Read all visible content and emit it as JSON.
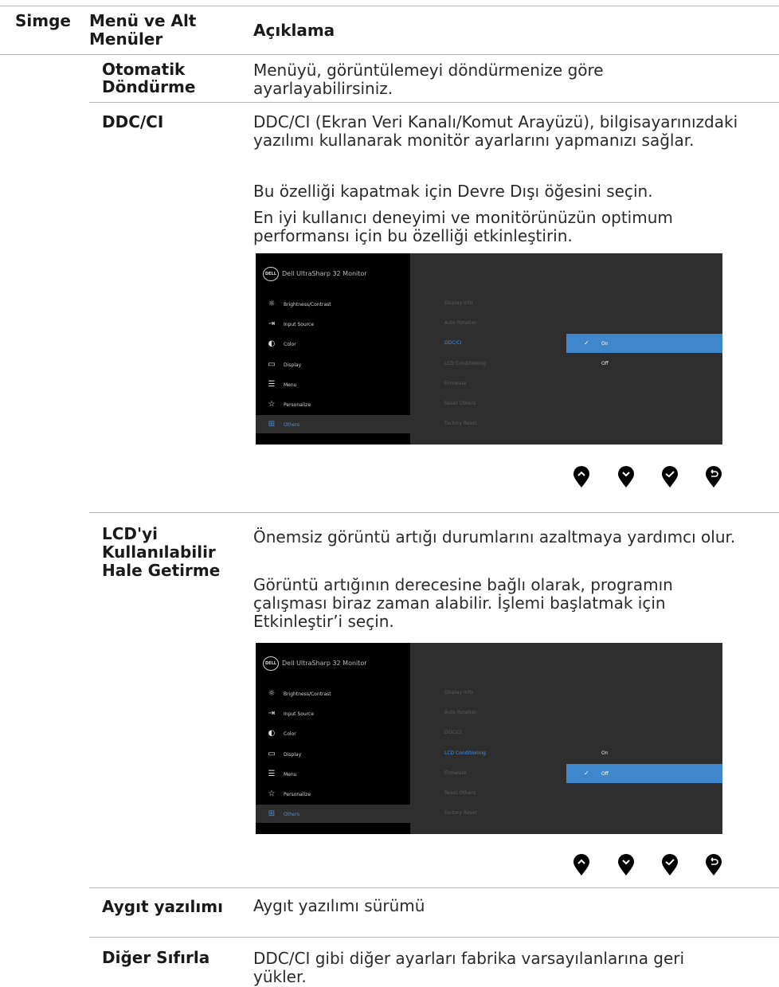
{
  "header": {
    "col1": "Simge",
    "col2": "Menü ve Alt Menüler",
    "col3": "Açıklama"
  },
  "rows": [
    {
      "term": "Otomatik Döndürme",
      "desc": [
        "Menüyü, görüntülemeyi döndürmenize göre ayarlayabilirsiniz."
      ]
    },
    {
      "term": "DDC/CI",
      "desc": [
        "DDC/CI (Ekran Veri Kanalı/Komut Arayüzü), bilgisayarınızdaki yazılımı kullanarak monitör ayarlarını yapmanızı sağlar.",
        "Bu özelliği kapatmak için Devre Dışı öğesini seçin.",
        "En iyi kullanıcı deneyimi ve monitörünüzün optimum performansı için bu özelliği etkinleştirin."
      ]
    },
    {
      "term": "LCD'yi Kullanılabilir Hale Getirme",
      "desc": [
        "Önemsiz görüntü artığı durumlarını azaltmaya yardımcı olur.",
        "Görüntü artığının derecesine bağlı olarak, programın çalışması biraz zaman alabilir. İşlemi başlatmak için Etkinleştir’i seçin."
      ]
    },
    {
      "term": "Aygıt yazılımı",
      "desc": [
        "Aygıt yazılımı sürümü"
      ]
    },
    {
      "term": "Diğer Sıfırla",
      "desc": [
        "DDC/CI gibi diğer ayarları fabrika varsayılanlarına geri yükler."
      ]
    }
  ],
  "osd": {
    "logo": "DELL",
    "title": "Dell UltraSharp 32 Monitor",
    "menu": [
      {
        "label": "Brightness/Contrast",
        "icon": "brightness-icon"
      },
      {
        "label": "Input Source",
        "icon": "input-source-icon"
      },
      {
        "label": "Color",
        "icon": "palette-icon"
      },
      {
        "label": "Display",
        "icon": "display-icon"
      },
      {
        "label": "Menu",
        "icon": "menu-icon"
      },
      {
        "label": "Personalize",
        "icon": "star-icon"
      },
      {
        "label": "Others",
        "icon": "others-icon"
      }
    ],
    "submenu": [
      "Display Info",
      "Auto Rotation",
      "DDC/CI",
      "LCD Conditioning",
      "Firmware",
      "Reset Others",
      "Factory Reset"
    ],
    "options_on": "On",
    "options_off": "Off"
  },
  "nav_buttons": [
    "up-button-icon",
    "down-button-icon",
    "check-button-icon",
    "back-button-icon"
  ]
}
